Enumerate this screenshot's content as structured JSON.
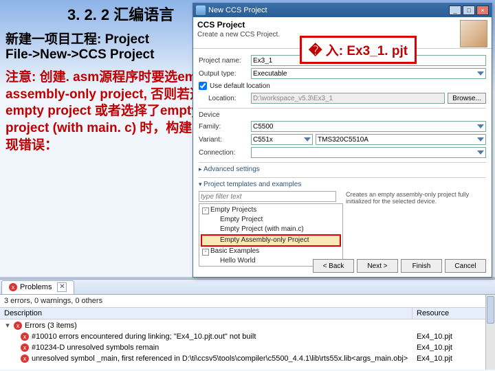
{
  "slide": {
    "heading": "3. 2. 2 汇编语言",
    "line1": "新建一项目工程: Project",
    "line2": "File->New->CCS Project",
    "note": "注意: 创建. asm源程序时要选empty assembly-only project, 否则若选empty project 或者选择了empty project (with main. c) 时，构建时会出现错误："
  },
  "annotation_input": "� 入: Ex3_1. pjt",
  "dialog": {
    "title": "New CCS Project",
    "banner_title": "CCS Project",
    "banner_sub": "Create a new CCS Project.",
    "labels": {
      "project_name": "Project name:",
      "output_type": "Output type:",
      "use_default": "Use default location",
      "location": "Location:",
      "browse": "Browse...",
      "device": "Device",
      "family": "Family:",
      "variant": "Variant:",
      "connection": "Connection:",
      "advanced": "Advanced settings",
      "templates": "Project templates and examples",
      "filter_ph": "type filter text",
      "template_desc": "Creates an empty assembly-only project fully initialized for the selected device.",
      "back": "< Back",
      "next": "Next >",
      "finish": "Finish",
      "cancel": "Cancel"
    },
    "values": {
      "project_name": "Ex3_1",
      "output_type": "Executable",
      "location": "D:\\workspace_v5.3\\Ex3_1",
      "family": "C5500",
      "variant_filter": "C551x",
      "variant": "TMS320C5510A",
      "connection": ""
    },
    "tree": {
      "g1": "Empty Projects",
      "l1": "Empty Project",
      "l2": "Empty Project (with main.c)",
      "l3": "Empty Assembly-only Project",
      "g2": "Basic Examples",
      "l4": "Hello World"
    }
  },
  "problems": {
    "tab": "Problems",
    "summary": "3 errors, 0 warnings, 0 others",
    "col_desc": "Description",
    "col_res": "Resource",
    "group": "Errors (3 items)",
    "e1": "#10010 errors encountered during linking; \"Ex4_10.pjt.out\" not built",
    "e2": "#10234-D unresolved symbols remain",
    "e3": "unresolved symbol _main, first referenced in D:\\ti\\ccsv5\\tools\\compiler\\c5500_4.4.1\\lib\\rts55x.lib<args_main.obj>",
    "r": "Ex4_10.pjt"
  }
}
